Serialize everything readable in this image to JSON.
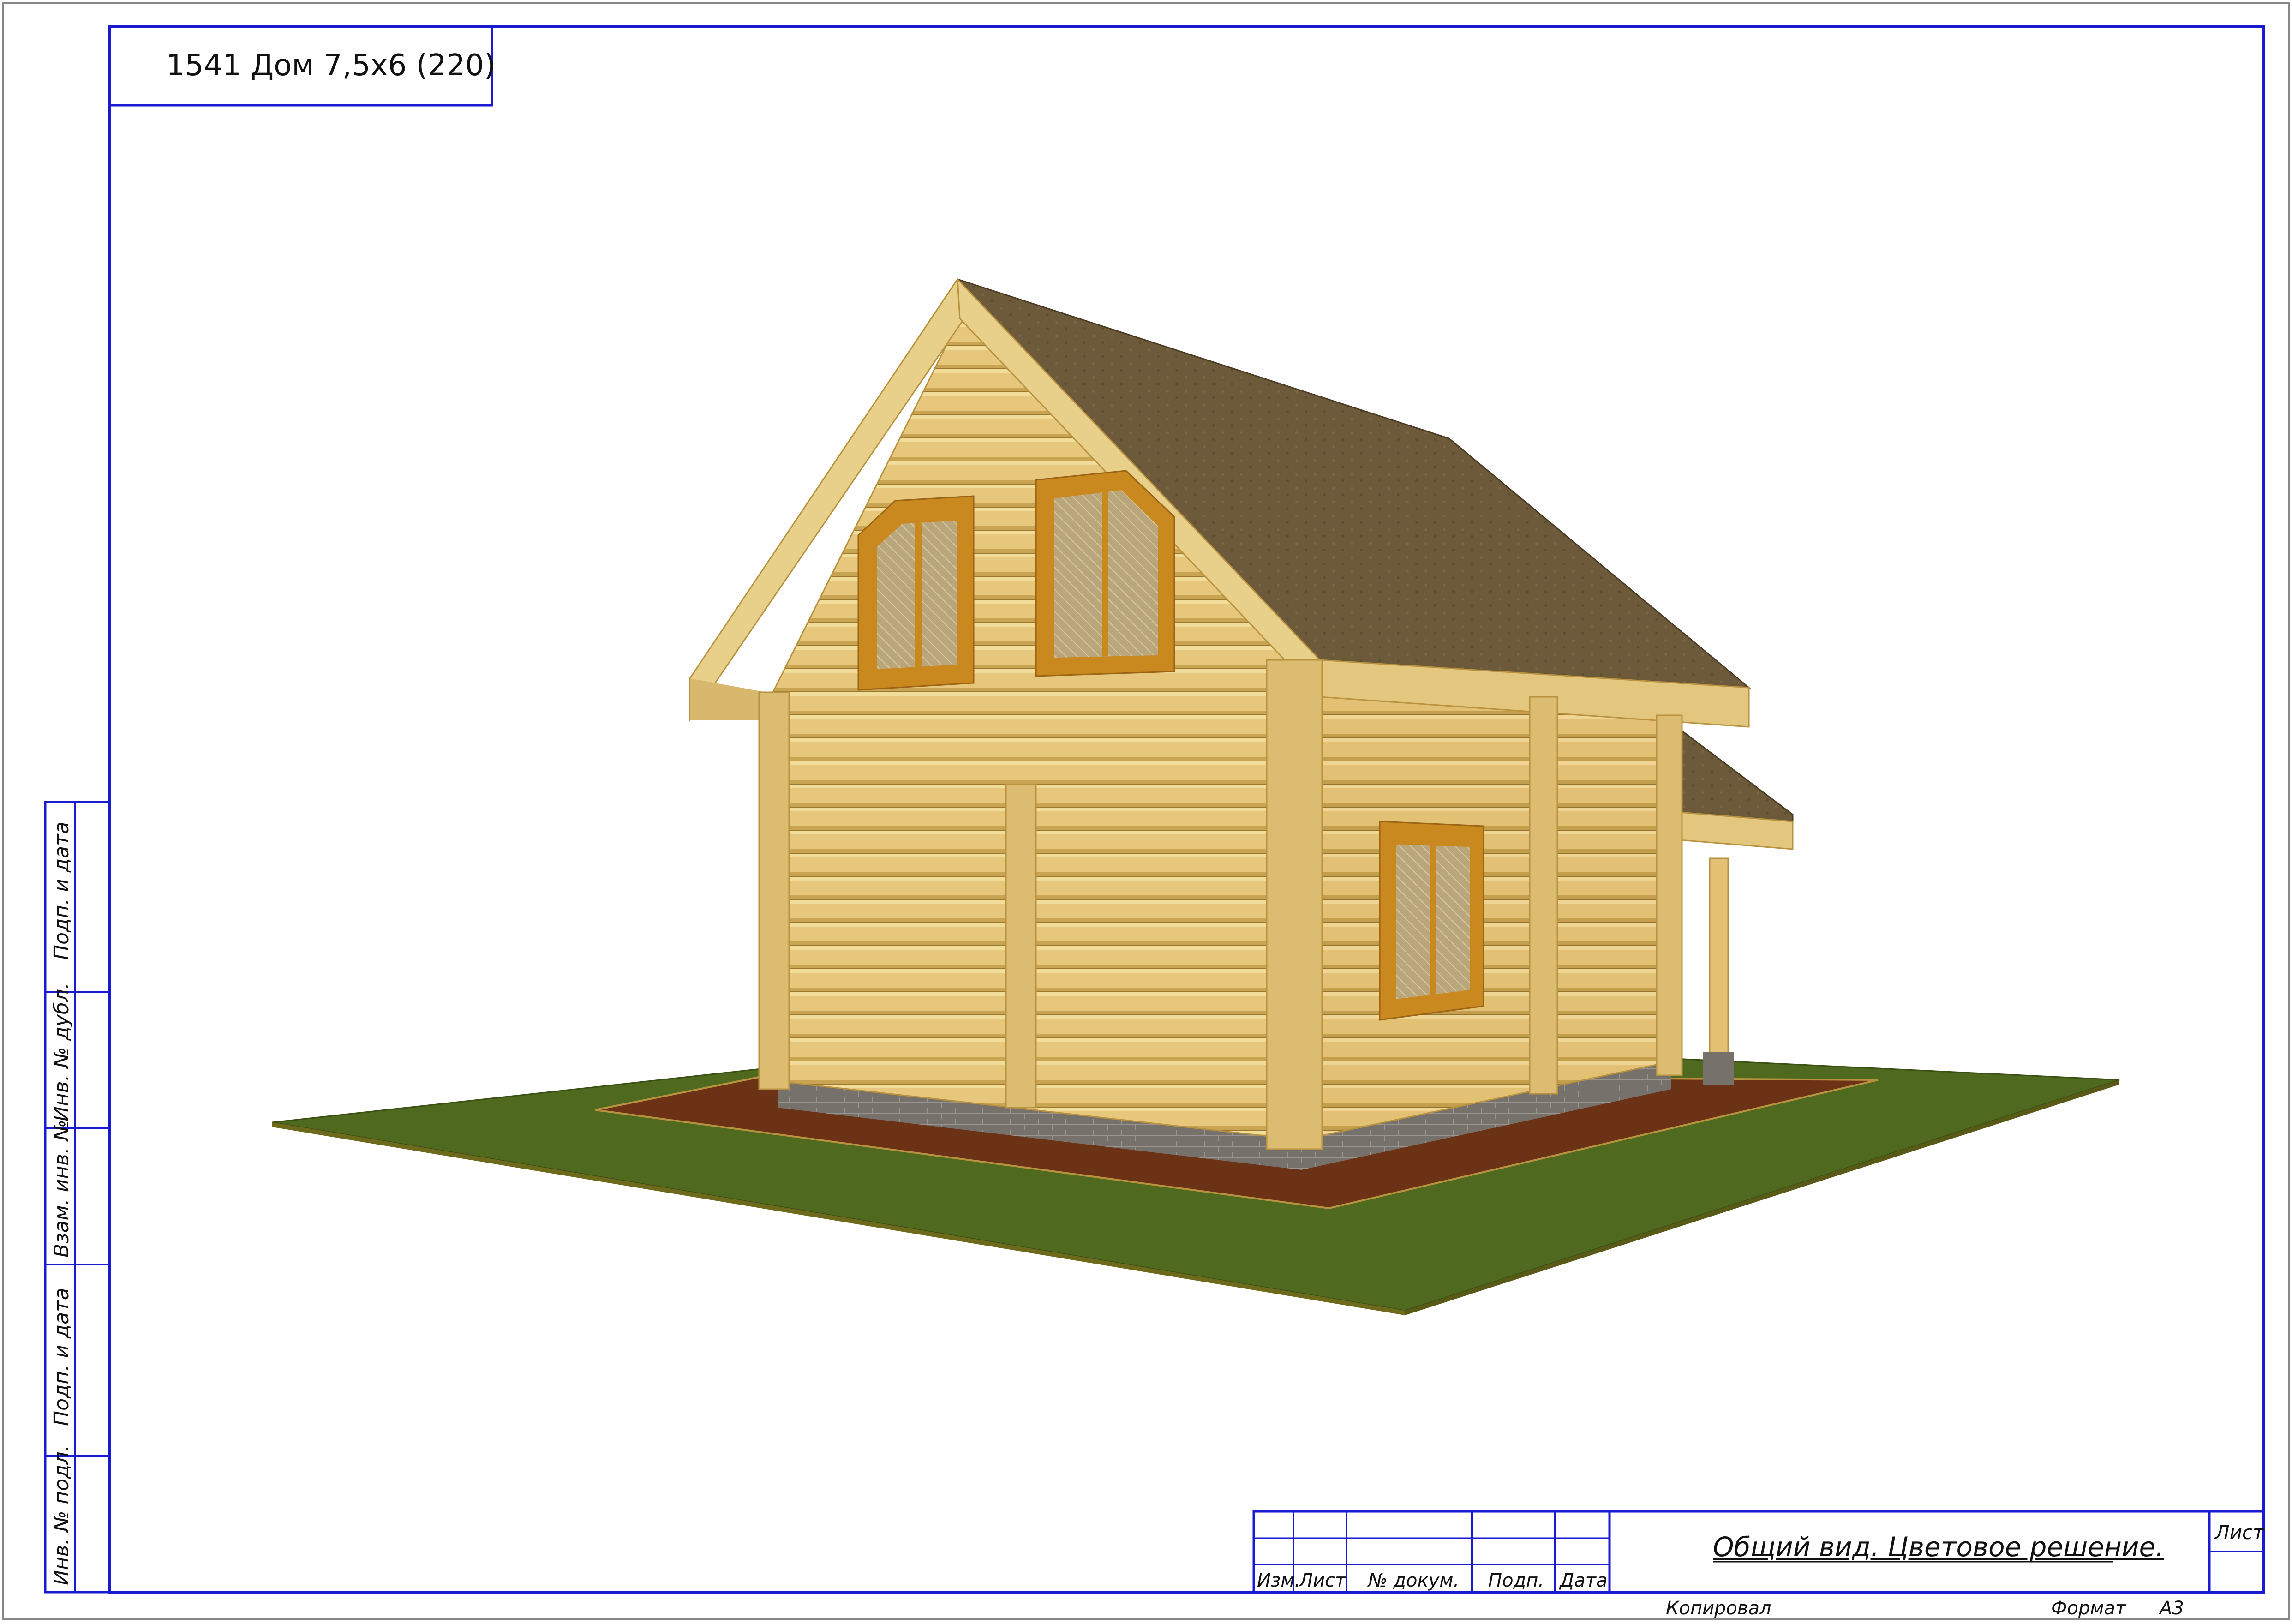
{
  "title_box": {
    "project": "1541 Дом 7,5х6 (220)"
  },
  "side_stamp": {
    "fields": [
      "Подп. и дата",
      "Инв. № дубл.",
      "Взам. инв. №",
      "Подп. и дата",
      "Инв. № подл."
    ]
  },
  "title_block": {
    "cols": [
      "Изм.",
      "Лист",
      "№ докум.",
      "Подп.",
      "Дата"
    ],
    "sheet_title": "Общий вид. Цветовое решение.",
    "sheet_label": "Лист",
    "copied": "Копировал",
    "format_label": "Формат",
    "format_value": "А3"
  },
  "colors": {
    "frame": "#1a1ad0",
    "log": "#e6c77c",
    "log_shadow": "#b8923e",
    "roof": "#6d5a3a",
    "grass": "#4f6a1e",
    "mulch": "#6b3216",
    "brick": "#77716c",
    "window_frame": "#c9891f"
  }
}
